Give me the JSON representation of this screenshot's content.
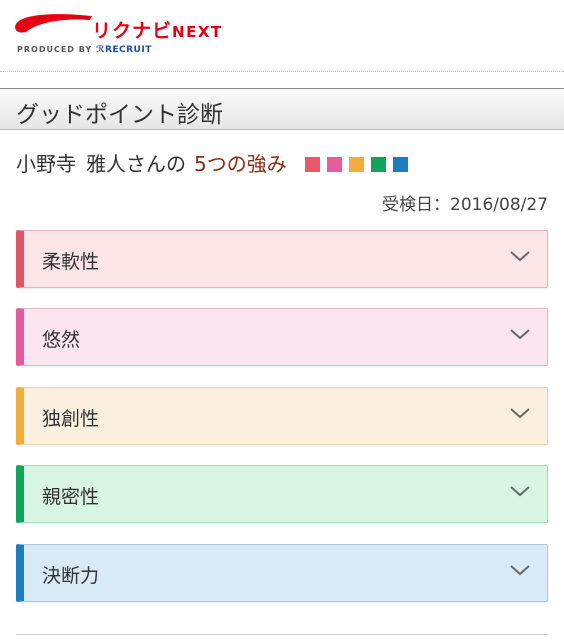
{
  "header": {
    "logo_main": "リクナビ",
    "logo_next": "NEXT",
    "produced_by": "PRODUCED BY",
    "produced_brand": "RECRUIT"
  },
  "page_title": "グッドポイント診断",
  "owner": {
    "name": "小野寺",
    "suffix": "雅人さんの",
    "strength_label": "5つの強み"
  },
  "strength_colors": [
    "#e8596b",
    "#e85c9e",
    "#f0ae3c",
    "#12a45a",
    "#1a7dc0"
  ],
  "exam_date": "受検日：2016/08/27",
  "strengths": [
    {
      "label": "柔軟性",
      "accent": "#e05565",
      "bg": "#fbe5e7",
      "border": "#e2b4b9",
      "icon": "chevron-down-icon"
    },
    {
      "label": "悠然",
      "accent": "#e35a9d",
      "bg": "#fbe5ef",
      "border": "#e6b4cb",
      "icon": "chevron-down-icon"
    },
    {
      "label": "独創性",
      "accent": "#f0ae3c",
      "bg": "#fbf0df",
      "border": "#e8d2ae",
      "icon": "chevron-down-icon"
    },
    {
      "label": "親密性",
      "accent": "#10a55a",
      "bg": "#d8f5e4",
      "border": "#aad9bd",
      "icon": "chevron-down-icon"
    },
    {
      "label": "決断力",
      "accent": "#1b7cc1",
      "bg": "#d8eaf6",
      "border": "#a8c8df",
      "icon": "chevron-down-icon"
    }
  ]
}
